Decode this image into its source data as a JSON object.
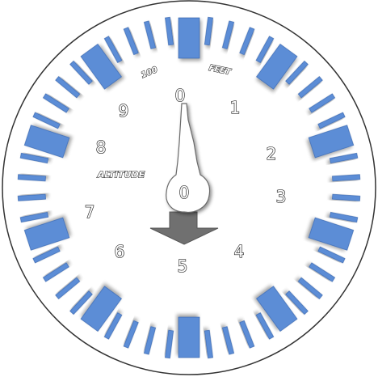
{
  "gauge": {
    "digits": [
      "0",
      "1",
      "2",
      "3",
      "4",
      "5",
      "6",
      "7",
      "8",
      "9"
    ],
    "label_100": "100",
    "label_feet": "FEET",
    "label_altitude": "ALTITUDE",
    "hub_label": "0",
    "pointer_reading": 0
  },
  "colors": {
    "face": "#ffffff",
    "rim": "#333333",
    "tick": "#5b8dd6",
    "tick_edge": "#2e5ea8",
    "needle": "#ffffff",
    "needle_edge": "#6a6a6a",
    "arrow": "#707070"
  }
}
